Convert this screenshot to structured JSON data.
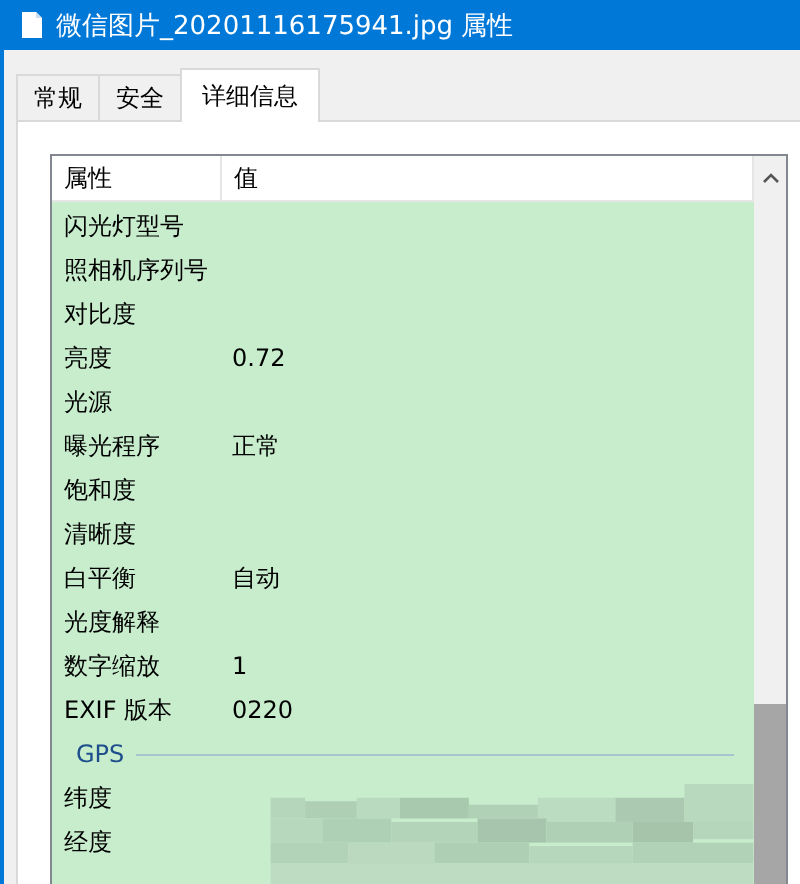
{
  "window": {
    "title": "微信图片_20201116175941.jpg 属性"
  },
  "tabs": [
    {
      "label": "常规",
      "selected": false
    },
    {
      "label": "安全",
      "selected": false
    },
    {
      "label": "详细信息",
      "selected": true
    }
  ],
  "list": {
    "columns": [
      "属性",
      "值"
    ],
    "rows": [
      {
        "kind": "property",
        "name": "闪光灯型号",
        "value": ""
      },
      {
        "kind": "property",
        "name": "照相机序列号",
        "value": ""
      },
      {
        "kind": "property",
        "name": "对比度",
        "value": ""
      },
      {
        "kind": "property",
        "name": "亮度",
        "value": "0.72"
      },
      {
        "kind": "property",
        "name": "光源",
        "value": ""
      },
      {
        "kind": "property",
        "name": "曝光程序",
        "value": "正常"
      },
      {
        "kind": "property",
        "name": "饱和度",
        "value": ""
      },
      {
        "kind": "property",
        "name": "清晰度",
        "value": ""
      },
      {
        "kind": "property",
        "name": "白平衡",
        "value": "自动"
      },
      {
        "kind": "property",
        "name": "光度解释",
        "value": ""
      },
      {
        "kind": "property",
        "name": "数字缩放",
        "value": "1"
      },
      {
        "kind": "property",
        "name": "EXIF 版本",
        "value": "0220"
      },
      {
        "kind": "group",
        "name": "GPS"
      },
      {
        "kind": "redacted",
        "name": "纬度"
      },
      {
        "kind": "redacted",
        "name": "经度"
      }
    ]
  }
}
